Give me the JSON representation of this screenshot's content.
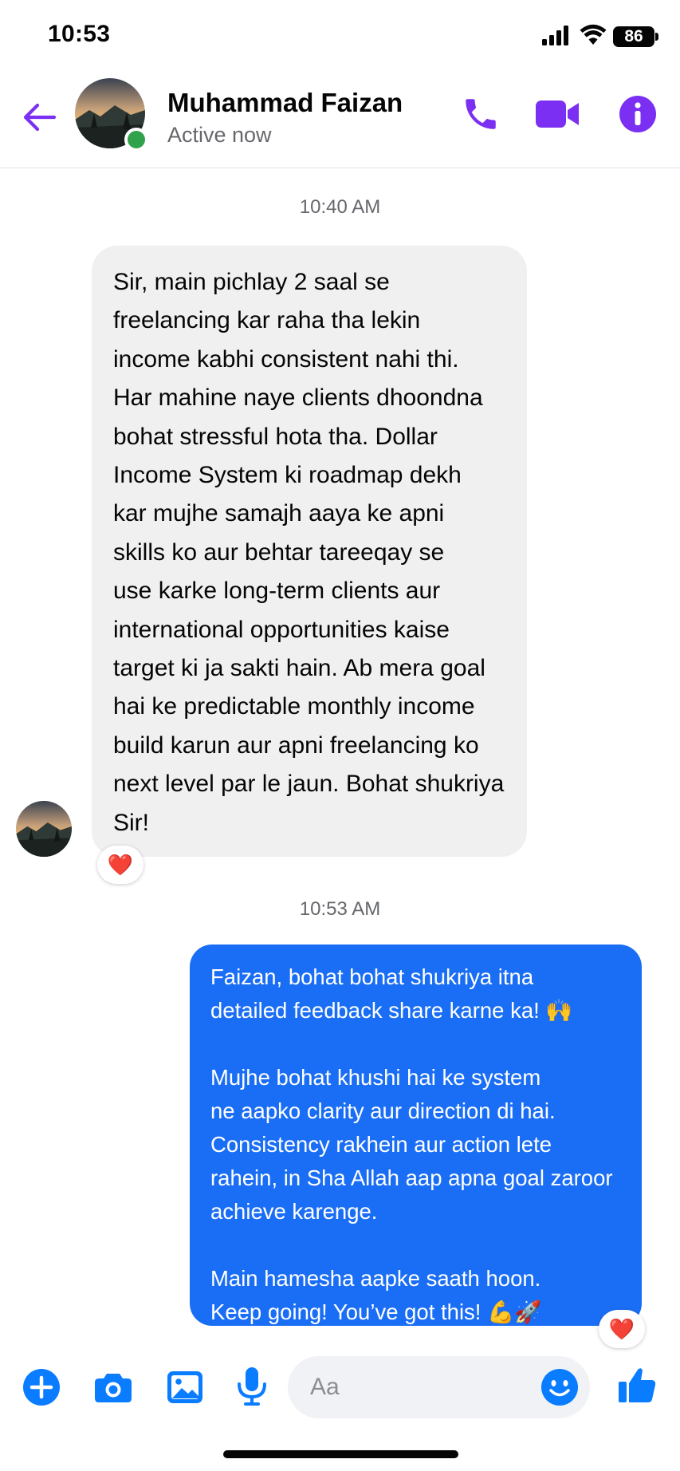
{
  "status_bar": {
    "time": "10:53",
    "battery": "86"
  },
  "header": {
    "contact_name": "Muhammad Faizan",
    "contact_status": "Active now",
    "icons": [
      "back-arrow-icon",
      "phone-icon",
      "video-camera-icon",
      "info-icon"
    ],
    "accent_color": "#7b2ff2"
  },
  "messages": [
    {
      "timestamp": "10:40 AM",
      "direction": "incoming",
      "text": "Sir,  main pichlay 2 saal se\nfreelancing kar raha tha lekin\nincome kabhi consistent nahi thi.\nHar mahine naye clients dhoondna\nbohat stressful hota tha. Dollar\nIncome System ki roadmap dekh\nkar mujhe samajh aaya ke apni\nskills ko aur behtar tareeqay se\nuse karke long-term clients aur\ninternational opportunities kaise\ntarget ki ja sakti hain. Ab mera goal\nhai ke predictable monthly income\nbuild karun aur apni freelancing ko\nnext level par le jaun. Bohat shukriya\nSir!",
      "reaction": "❤️"
    },
    {
      "timestamp": "10:53 AM",
      "direction": "outgoing",
      "text": "Faizan, bohat bohat shukriya itna\ndetailed feedback share karne ka! 🙌\n\nMujhe bohat khushi hai ke system\nne aapko clarity aur direction di hai.\nConsistency rakhein aur action lete\nrahein, in Sha Allah aap apna goal zaroor\nachieve karenge.\n\nMain hamesha aapke saath hoon.\nKeep going! You’ve got this! 💪🚀",
      "reaction": "❤️",
      "bubble_color": "#1a6ef5"
    }
  ],
  "composer": {
    "placeholder": "Aa",
    "icons": [
      "plus-icon",
      "camera-icon",
      "image-icon",
      "microphone-icon",
      "emoji-icon",
      "thumbs-up-icon"
    ],
    "icon_color": "#0a7cff"
  }
}
